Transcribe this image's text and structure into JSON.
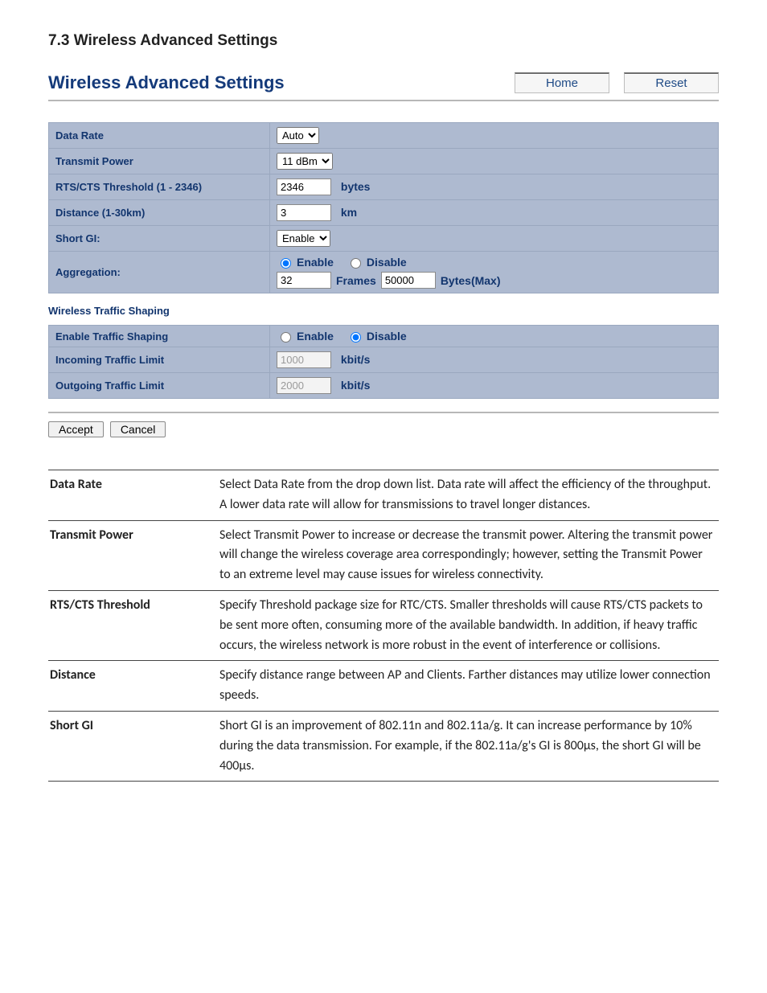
{
  "section_heading": "7.3 Wireless Advanced Settings",
  "panel": {
    "title": "Wireless Advanced Settings",
    "home": "Home",
    "reset": "Reset"
  },
  "settings": {
    "data_rate": {
      "label": "Data Rate",
      "value": "Auto"
    },
    "tx_power": {
      "label": "Transmit Power",
      "value": "11 dBm"
    },
    "rts": {
      "label": "RTS/CTS Threshold (1 - 2346)",
      "value": "2346",
      "unit": "bytes"
    },
    "distance": {
      "label": "Distance (1-30km)",
      "value": "3",
      "unit": "km"
    },
    "short_gi": {
      "label": "Short GI:",
      "value": "Enable"
    },
    "aggregation": {
      "label": "Aggregation:",
      "enable": "Enable",
      "disable": "Disable",
      "frames_value": "32",
      "frames_label": "Frames",
      "bytes_value": "50000",
      "bytes_label": "Bytes(Max)"
    }
  },
  "shaping": {
    "heading": "Wireless Traffic Shaping",
    "enable_row": {
      "label": "Enable Traffic Shaping",
      "enable": "Enable",
      "disable": "Disable"
    },
    "incoming": {
      "label": "Incoming Traffic Limit",
      "value": "1000",
      "unit": "kbit/s"
    },
    "outgoing": {
      "label": "Outgoing Traffic Limit",
      "value": "2000",
      "unit": "kbit/s"
    }
  },
  "actions": {
    "accept": "Accept",
    "cancel": "Cancel"
  },
  "descriptions": [
    {
      "term": "Data Rate",
      "text": "Select Data Rate from the drop down list. Data rate will affect the efficiency of the throughput. A lower data rate will allow for transmissions to travel longer distances."
    },
    {
      "term": "Transmit Power",
      "text": "Select Transmit Power to increase or decrease the transmit power. Altering the transmit power will change the wireless coverage area correspondingly; however, setting the Transmit Power to an extreme level may cause issues for wireless connectivity."
    },
    {
      "term": "RTS/CTS Threshold",
      "text": "Specify Threshold package size for RTC/CTS. Smaller thresholds will cause RTS/CTS packets to be sent more often, consuming more of the available bandwidth. In addition, if heavy traffic occurs, the wireless network is more robust in the event of interference or collisions."
    },
    {
      "term": "Distance",
      "text": "Specify distance range between AP and Clients. Farther distances may utilize lower connection speeds."
    },
    {
      "term": "Short GI",
      "text": "Short GI is an improvement of 802.11n and 802.11a/g. It can increase performance by 10% during the data transmission. For example, if the 802.11a/g's GI is 800μs, the short GI will be 400μs."
    }
  ]
}
